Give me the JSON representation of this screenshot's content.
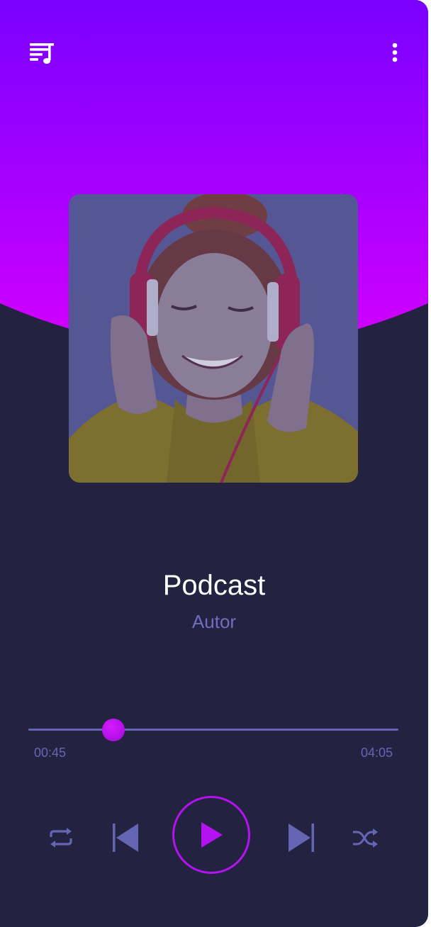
{
  "header": {
    "left_icon": "playlist-music-icon",
    "right_icon": "more-vertical-icon"
  },
  "colors": {
    "gradient_top": "#7c00ff",
    "gradient_bottom": "#d000ff",
    "background": "#232240",
    "accent": "#b412f0",
    "muted": "#6466b4",
    "text": "#ffffff"
  },
  "track": {
    "title": "Podcast",
    "author": "Autor",
    "artwork_icon": "woman-with-headphones-photo"
  },
  "progress": {
    "elapsed": "00:45",
    "total": "04:05",
    "fraction": 0.23
  },
  "controls": {
    "repeat_icon": "repeat-icon",
    "previous_icon": "skip-previous-icon",
    "play_icon": "play-icon",
    "next_icon": "skip-next-icon",
    "shuffle_icon": "shuffle-icon"
  }
}
